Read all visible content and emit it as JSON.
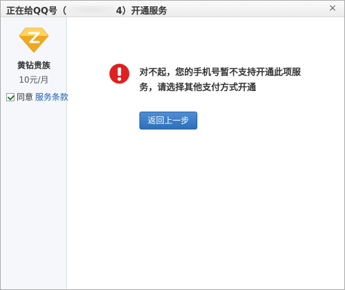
{
  "window": {
    "title_prefix": "正在给QQ号（",
    "title_suffix": "4）开通服务",
    "close_glyph": "×"
  },
  "sidebar": {
    "product_name": "黄钻贵族",
    "price": "10元/月",
    "agree_label": "同意",
    "terms_link": "服务条款",
    "agree_checked": true
  },
  "main": {
    "error_message": "对不起，您的手机号暂不支持开通此项服务，请选择其他支付方式开通",
    "back_button": "返回上一步"
  },
  "icons": {
    "product": "yellow-diamond-icon",
    "error": "error-exclamation-icon",
    "close": "close-icon"
  },
  "colors": {
    "error_red": "#e02020",
    "diamond_yellow": "#f5b82e",
    "link_blue": "#1f5fb3",
    "button_blue": "#3a7cc6"
  }
}
